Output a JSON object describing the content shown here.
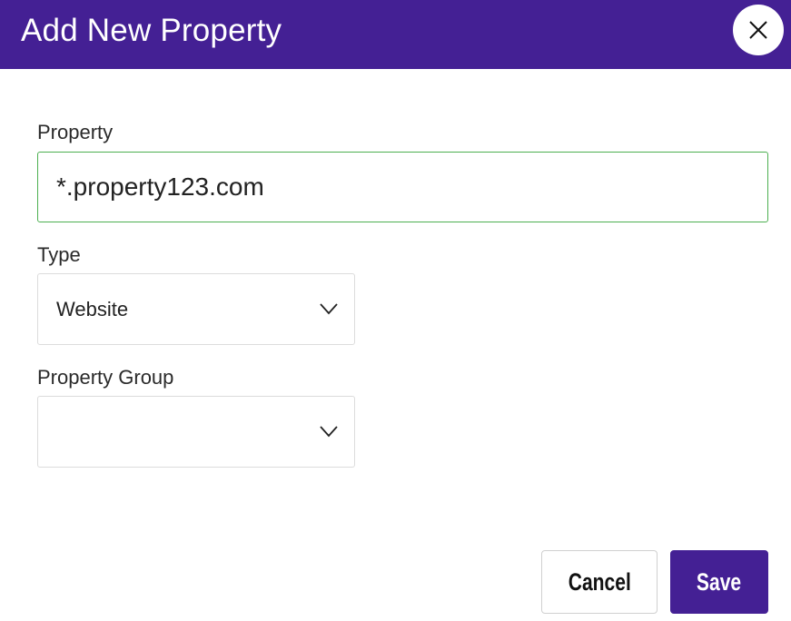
{
  "dialog": {
    "title": "Add New Property",
    "close_icon": "close-icon"
  },
  "form": {
    "property": {
      "label": "Property",
      "value": "*.property123.com"
    },
    "type": {
      "label": "Type",
      "selected": "Website",
      "icon": "chevron-down-icon"
    },
    "property_group": {
      "label": "Property Group",
      "selected": "",
      "icon": "chevron-down-icon"
    }
  },
  "actions": {
    "cancel_label": "Cancel",
    "save_label": "Save"
  },
  "colors": {
    "brand": "#442094",
    "focus_border": "#4caf50"
  }
}
